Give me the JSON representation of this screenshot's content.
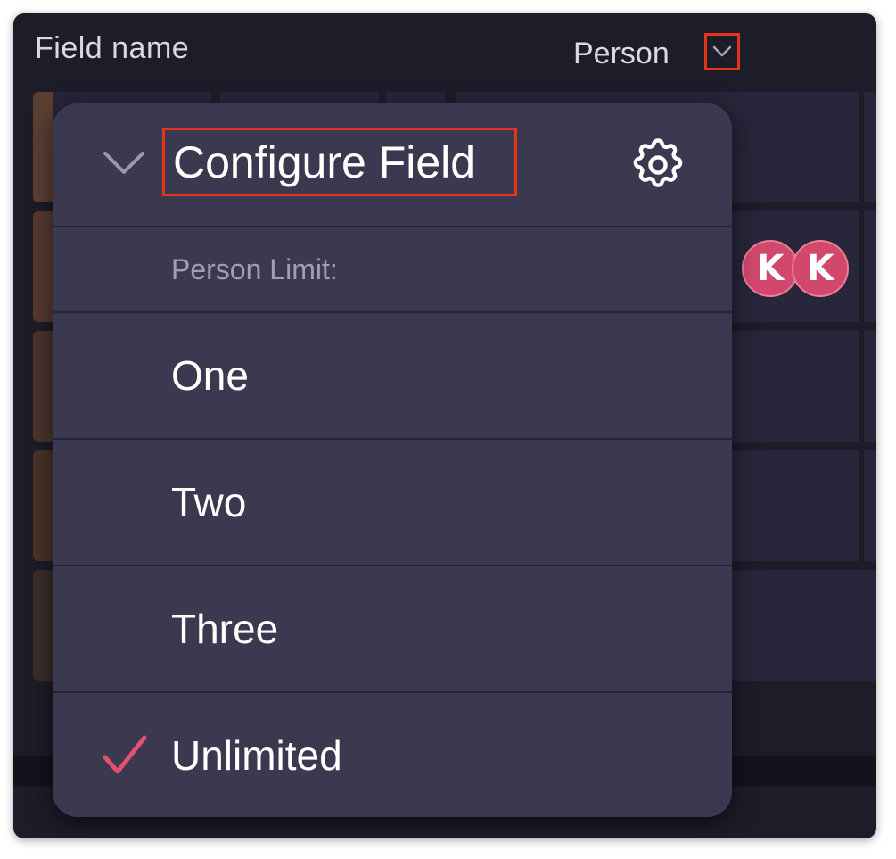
{
  "header": {
    "field_name_label": "Field name",
    "column_label": "Person"
  },
  "avatars": [
    "K",
    "K"
  ],
  "popover": {
    "title": "Configure Field",
    "section_label": "Person Limit:",
    "options": [
      {
        "label": "One",
        "selected": false
      },
      {
        "label": "Two",
        "selected": false
      },
      {
        "label": "Three",
        "selected": false
      },
      {
        "label": "Unlimited",
        "selected": true
      }
    ]
  },
  "colors": {
    "background": "#1d1c29",
    "popover_bg": "#3a394f",
    "highlight_outline": "#e8331a",
    "check_accent": "#e5506f",
    "avatar_bg": "#d2486d",
    "row_swatch": "#5c3f33"
  },
  "icons": {
    "column_menu": "chevron-down-icon",
    "collapse": "chevron-down-icon",
    "settings": "gear-icon",
    "selected": "checkmark-icon"
  }
}
